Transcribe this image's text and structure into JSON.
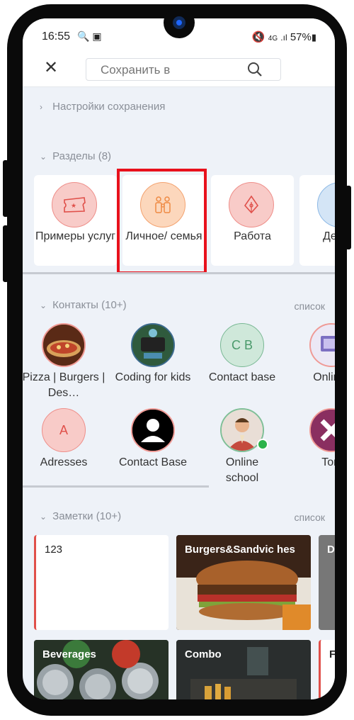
{
  "status": {
    "time": "16:55",
    "left_icons": "🔍 ▣",
    "right": "🔇 ⁴ᴳ .ıl 57%▮",
    "battery": "57%"
  },
  "search": {
    "placeholder": "Сохранить в"
  },
  "settings": {
    "label": "Настройки сохранения"
  },
  "sections": {
    "label": "Разделы (8)",
    "items": [
      {
        "label": "Примеры услуг",
        "icon": "ticket-icon",
        "color": "#f5b8b5"
      },
      {
        "label": "Личное/ семья",
        "icon": "family-icon",
        "color": "#fbd1b2"
      },
      {
        "label": "Работа",
        "icon": "pen-nib-icon",
        "color": "#f5b8b5"
      },
      {
        "label": "Дед на",
        "icon": "globe-icon",
        "color": "#c5dcf2"
      }
    ]
  },
  "contacts": {
    "label": "Контакты (10+)",
    "list_link": "список",
    "items": [
      {
        "name": "Pizza | Burgers | Des…",
        "type": "photo-pizza"
      },
      {
        "name": "Coding for kids",
        "type": "photo-coding"
      },
      {
        "name": "Contact base",
        "initials": "C B",
        "type": "initials"
      },
      {
        "name": "Online-",
        "type": "photo-online"
      },
      {
        "name": "Adresses",
        "initials": "A",
        "type": "initials"
      },
      {
        "name": "Contact Base",
        "type": "person"
      },
      {
        "name": "Online school",
        "type": "photo-man"
      },
      {
        "name": "Torr",
        "type": "photo-x"
      }
    ]
  },
  "notes": {
    "label": "Заметки (10+)",
    "list_link": "список",
    "items": [
      {
        "title": "123"
      },
      {
        "title": "Burgers&Sandvic hes"
      },
      {
        "title": "D"
      },
      {
        "title": "Beverages"
      },
      {
        "title": "Combo"
      },
      {
        "title": "F"
      }
    ]
  }
}
